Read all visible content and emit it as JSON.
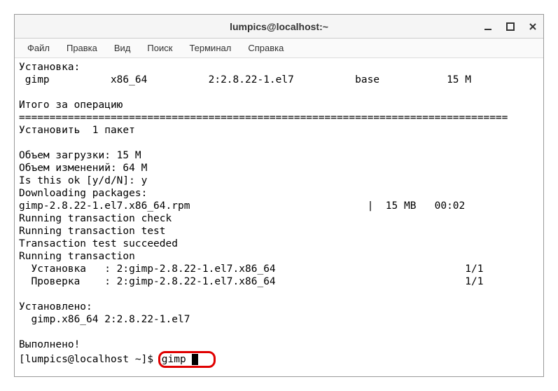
{
  "window": {
    "title": "lumpics@localhost:~"
  },
  "menubar": {
    "items": [
      {
        "label": "Файл"
      },
      {
        "label": "Правка"
      },
      {
        "label": "Вид"
      },
      {
        "label": "Поиск"
      },
      {
        "label": "Терминал"
      },
      {
        "label": "Справка"
      }
    ]
  },
  "terminal": {
    "lines": {
      "l0": "Установка:",
      "l1": " gimp          x86_64          2:2.8.22-1.el7          base           15 M",
      "l2": "",
      "l3": "Итого за операцию",
      "l4": "================================================================================",
      "l5": "Установить  1 пакет",
      "l6": "",
      "l7": "Объем загрузки: 15 M",
      "l8": "Объем изменений: 64 M",
      "l9": "Is this ok [y/d/N]: y",
      "l10": "Downloading packages:",
      "l11": "gimp-2.8.22-1.el7.x86_64.rpm                             |  15 MB   00:02",
      "l12": "Running transaction check",
      "l13": "Running transaction test",
      "l14": "Transaction test succeeded",
      "l15": "Running transaction",
      "l16": "  Установка   : 2:gimp-2.8.22-1.el7.x86_64                               1/1",
      "l17": "  Проверка    : 2:gimp-2.8.22-1.el7.x86_64                               1/1",
      "l18": "",
      "l19": "Установлено:",
      "l20": "  gimp.x86_64 2:2.8.22-1.el7",
      "l21": "",
      "l22": "Выполнено!"
    },
    "prompt": "[lumpics@localhost ~]$ ",
    "command": "gimp "
  }
}
